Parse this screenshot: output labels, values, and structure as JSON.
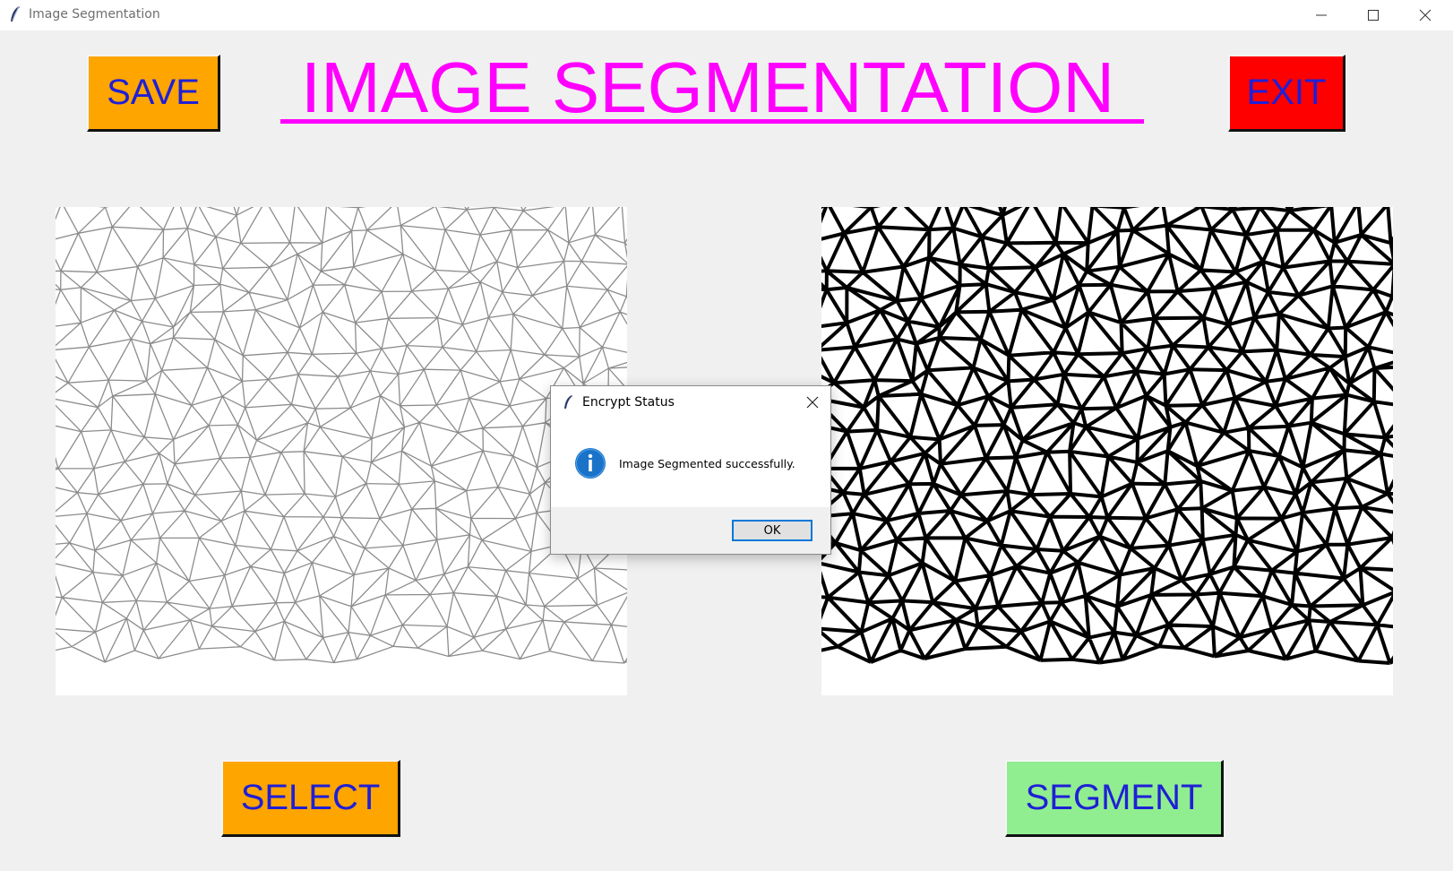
{
  "window": {
    "title": "Image Segmentation",
    "icon": "tk-feather-icon"
  },
  "toolbar": {
    "save_label": "SAVE",
    "exit_label": "EXIT",
    "app_title": "IMAGE SEGMENTATION",
    "title_color": "#ff00ff",
    "save_color": "#ffa500",
    "exit_color": "#ff0000"
  },
  "images": {
    "original": "voronoi-cell-pattern-light",
    "segmented": "voronoi-cell-pattern-bold"
  },
  "actions": {
    "select_label": "SELECT",
    "segment_label": "SEGMENT",
    "select_color": "#ffa500",
    "segment_color": "#90ee90"
  },
  "dialog": {
    "title": "Encrypt Status",
    "icon": "info-icon",
    "message": "Image Segmented successfully.",
    "ok_label": "OK"
  }
}
